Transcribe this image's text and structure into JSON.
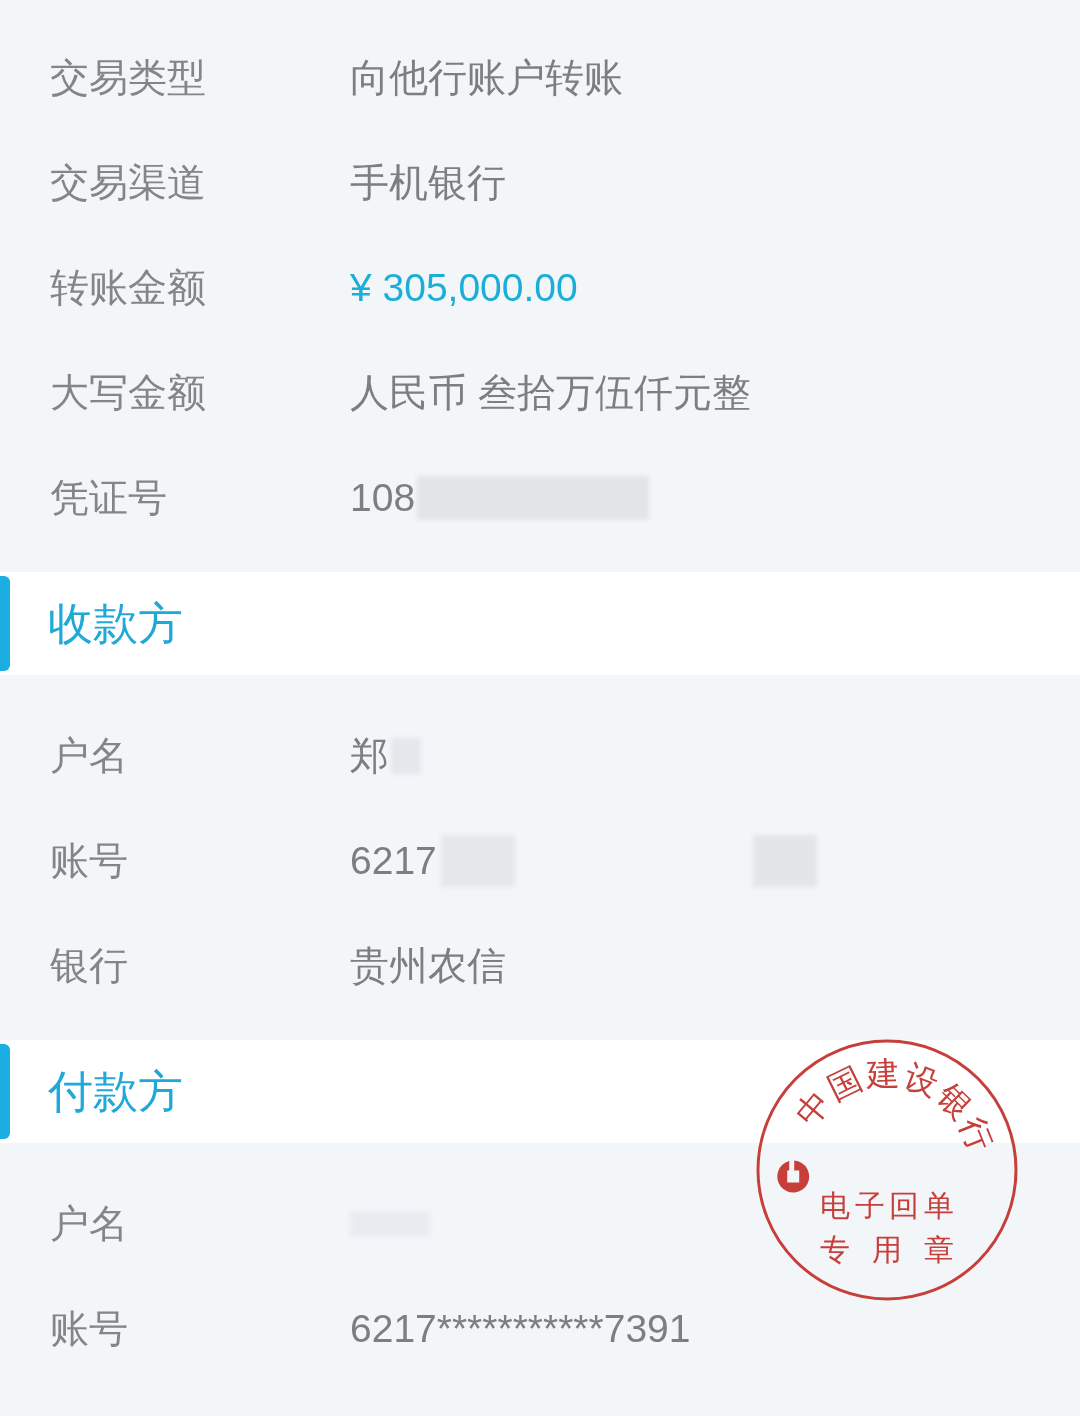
{
  "sections": [
    {
      "rows": [
        {
          "kind": "text",
          "label": "交易类型",
          "value": "向他行账户转账"
        },
        {
          "kind": "text",
          "label": "交易渠道",
          "value": "手机银行"
        },
        {
          "kind": "amount",
          "label": "转账金额",
          "value": "¥ 305,000.00"
        },
        {
          "kind": "text",
          "label": "大写金额",
          "value": "人民币 叁拾万伍仟元整"
        },
        {
          "kind": "text",
          "label": "凭证号",
          "value": "108",
          "redactions": [
            {
              "kind": "long"
            }
          ]
        }
      ]
    },
    {
      "title": "收款方",
      "rows": [
        {
          "kind": "text",
          "label": "户名",
          "value": "郑",
          "redactions": [
            {
              "kind": "smudge"
            }
          ]
        },
        {
          "kind": "text",
          "label": "账号",
          "value": "6217",
          "redactions": [
            {
              "kind": "short"
            },
            {
              "kind": "distant"
            }
          ]
        },
        {
          "kind": "text",
          "label": "银行",
          "value": "贵州农信"
        }
      ]
    },
    {
      "title": "付款方",
      "rows": [
        {
          "kind": "text",
          "label": "户名",
          "redactions": [
            {
              "kind": "faint"
            }
          ]
        },
        {
          "kind": "text",
          "label": "账号",
          "value": "6217***********7391"
        }
      ]
    }
  ],
  "seal": {
    "ring_text": "中国建设银行",
    "center_lines": [
      "电子回单",
      "专用章"
    ]
  }
}
